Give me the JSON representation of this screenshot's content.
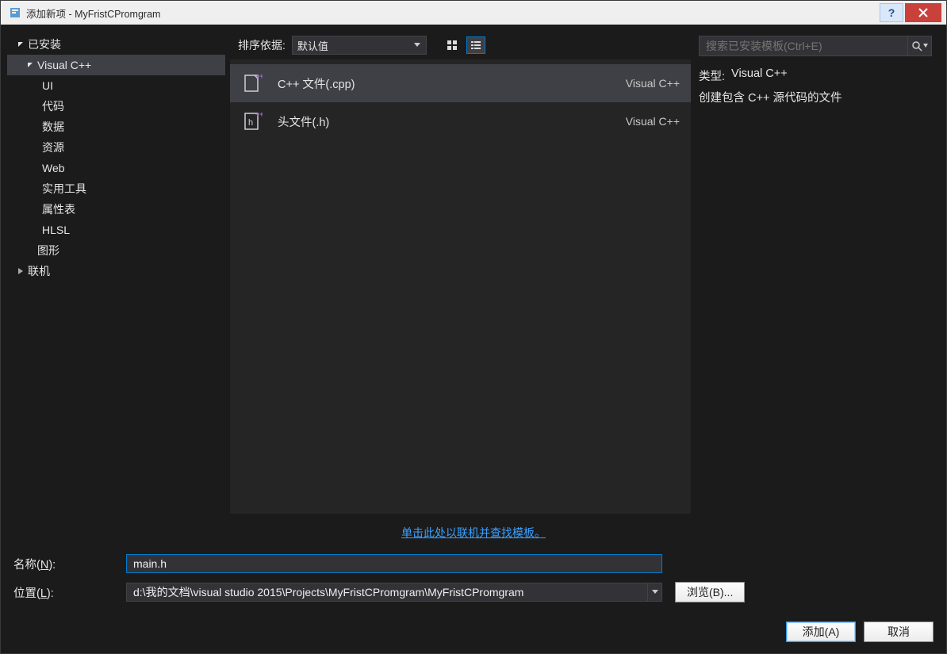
{
  "titlebar": {
    "title": "添加新项 - MyFristCPromgram"
  },
  "tree": {
    "installed": "已安装",
    "visual_cpp": "Visual C++",
    "children": [
      "UI",
      "代码",
      "数据",
      "资源",
      "Web",
      "实用工具",
      "属性表",
      "HLSL"
    ],
    "graphics": "图形",
    "online": "联机"
  },
  "sort": {
    "label": "排序依据:",
    "value": "默认值"
  },
  "templates": [
    {
      "name": "C++ 文件(.cpp)",
      "lang": "Visual C++",
      "selected": true
    },
    {
      "name": "头文件(.h)",
      "lang": "Visual C++",
      "selected": false
    }
  ],
  "search": {
    "placeholder": "搜索已安装模板(Ctrl+E)"
  },
  "detail": {
    "type_label": "类型:",
    "type_value": "Visual C++",
    "description": "创建包含 C++ 源代码的文件"
  },
  "online_link": "单击此处以联机并查找模板。",
  "form": {
    "name_label": "名称(N):",
    "name_label_pre": "名称(",
    "name_label_u": "N",
    "name_label_post": "):",
    "name_value": "main.h",
    "loc_label_pre": "位置(",
    "loc_label_u": "L",
    "loc_label_post": "):",
    "loc_value": "d:\\我的文档\\visual studio 2015\\Projects\\MyFristCPromgram\\MyFristCPromgram",
    "browse": "浏览(B)..."
  },
  "buttons": {
    "add": "添加(A)",
    "cancel": "取消"
  }
}
